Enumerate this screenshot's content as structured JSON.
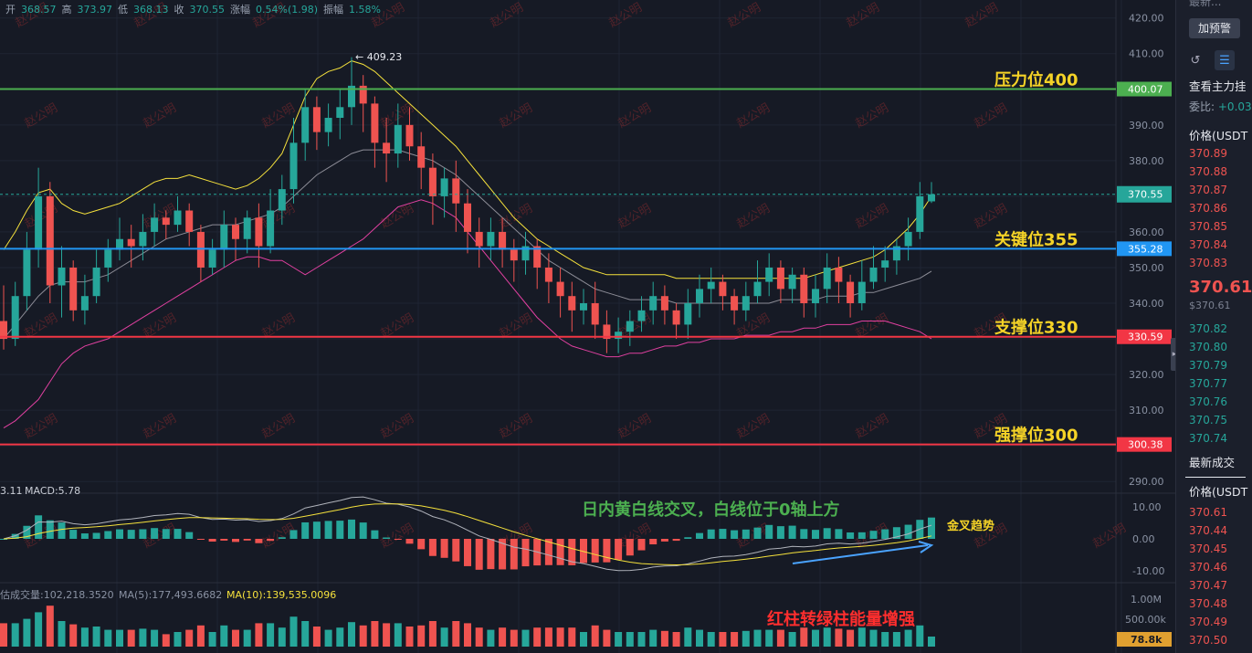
{
  "ohlc_header": {
    "open_label": "开",
    "open": "368.57",
    "high_label": "高",
    "high": "373.97",
    "low_label": "低",
    "low": "368.13",
    "close_label": "收",
    "close": "370.55",
    "change_label": "涨幅",
    "change": "0.54%(1.98)",
    "amplitude_label": "振幅",
    "amplitude": "1.58%"
  },
  "watermark_text": "赵公明",
  "colors": {
    "up": "#26a69a",
    "down": "#ef5350",
    "background": "#161a25",
    "resistance": "#4caf50",
    "key": "#2196f3",
    "support": "#f23645",
    "bb_upper": "#f5e13c",
    "bb_mid": "#8c8c96",
    "bb_lower": "#e040a0",
    "annotation_yellow": "#f5d327",
    "annotation_green": "#4caf50",
    "annotation_red": "#ff2e2e",
    "arrow_blue": "#4aa3ff"
  },
  "chart_data": [
    {
      "type": "candlestick",
      "panel": "price",
      "y_axis_ticks": [
        "420.00",
        "410.00",
        "400.00",
        "390.00",
        "380.00",
        "370.00",
        "360.00",
        "350.00",
        "340.00",
        "330.00",
        "320.00",
        "310.00",
        "300.00",
        "290.00"
      ],
      "ylim": [
        288,
        423
      ],
      "high_marker": "← 409.23",
      "candles": [
        [
          335,
          330,
          345,
          327
        ],
        [
          330,
          342,
          346,
          328
        ],
        [
          342,
          355,
          360,
          338
        ],
        [
          355,
          370,
          378,
          350
        ],
        [
          370,
          345,
          374,
          340
        ],
        [
          345,
          350,
          356,
          336
        ],
        [
          350,
          338,
          352,
          335
        ],
        [
          338,
          342,
          348,
          334
        ],
        [
          342,
          350,
          355,
          340
        ],
        [
          350,
          355,
          358,
          346
        ],
        [
          355,
          358,
          364,
          352
        ],
        [
          358,
          356,
          362,
          350
        ],
        [
          356,
          360,
          365,
          352
        ],
        [
          360,
          364,
          368,
          356
        ],
        [
          364,
          362,
          366,
          358
        ],
        [
          362,
          366,
          370,
          360
        ],
        [
          366,
          360,
          368,
          356
        ],
        [
          360,
          350,
          362,
          346
        ],
        [
          350,
          355,
          358,
          348
        ],
        [
          355,
          362,
          366,
          350
        ],
        [
          362,
          358,
          364,
          352
        ],
        [
          358,
          364,
          366,
          354
        ],
        [
          364,
          356,
          368,
          350
        ],
        [
          356,
          366,
          372,
          354
        ],
        [
          366,
          372,
          376,
          362
        ],
        [
          372,
          385,
          392,
          368
        ],
        [
          385,
          395,
          400,
          380
        ],
        [
          395,
          388,
          398,
          383
        ],
        [
          388,
          392,
          396,
          384
        ],
        [
          392,
          395,
          400,
          386
        ],
        [
          395,
          401,
          409,
          390
        ],
        [
          401,
          396,
          404,
          388
        ],
        [
          396,
          385,
          398,
          378
        ],
        [
          385,
          382,
          392,
          374
        ],
        [
          382,
          390,
          396,
          378
        ],
        [
          390,
          384,
          395,
          380
        ],
        [
          384,
          378,
          388,
          372
        ],
        [
          378,
          370,
          382,
          362
        ],
        [
          370,
          375,
          378,
          364
        ],
        [
          375,
          368,
          380,
          360
        ],
        [
          368,
          360,
          372,
          354
        ],
        [
          360,
          356,
          364,
          350
        ],
        [
          356,
          360,
          364,
          352
        ],
        [
          360,
          355,
          364,
          350
        ],
        [
          355,
          352,
          358,
          346
        ],
        [
          352,
          356,
          360,
          348
        ],
        [
          356,
          350,
          358,
          344
        ],
        [
          350,
          346,
          354,
          340
        ],
        [
          346,
          342,
          350,
          336
        ],
        [
          342,
          338,
          346,
          332
        ],
        [
          338,
          340,
          344,
          334
        ],
        [
          340,
          334,
          346,
          330
        ],
        [
          334,
          330,
          338,
          326
        ],
        [
          330,
          332,
          336,
          326
        ],
        [
          332,
          335,
          338,
          328
        ],
        [
          335,
          338,
          342,
          332
        ],
        [
          338,
          342,
          346,
          334
        ],
        [
          342,
          338,
          345,
          334
        ],
        [
          338,
          334,
          340,
          330
        ],
        [
          334,
          340,
          344,
          330
        ],
        [
          340,
          344,
          348,
          336
        ],
        [
          344,
          346,
          350,
          340
        ],
        [
          346,
          342,
          348,
          338
        ],
        [
          342,
          338,
          344,
          334
        ],
        [
          338,
          342,
          346,
          335
        ],
        [
          342,
          346,
          352,
          340
        ],
        [
          346,
          350,
          354,
          342
        ],
        [
          350,
          344,
          352,
          340
        ],
        [
          344,
          348,
          350,
          340
        ],
        [
          348,
          340,
          350,
          336
        ],
        [
          340,
          344,
          348,
          336
        ],
        [
          344,
          350,
          354,
          340
        ],
        [
          350,
          346,
          353,
          340
        ],
        [
          346,
          340,
          348,
          336
        ],
        [
          340,
          346,
          352,
          338
        ],
        [
          346,
          350,
          356,
          344
        ],
        [
          350,
          352,
          356,
          346
        ],
        [
          352,
          356,
          358,
          348
        ],
        [
          356,
          360,
          364,
          352
        ],
        [
          360,
          370,
          374,
          358
        ],
        [
          368.57,
          370.55,
          373.97,
          368.13
        ]
      ],
      "bollinger": {
        "upper": [
          355,
          360,
          366,
          371,
          372,
          368,
          366,
          365,
          366,
          367,
          368,
          370,
          372,
          374,
          375,
          375,
          376,
          375,
          374,
          373,
          372,
          373,
          375,
          378,
          382,
          390,
          398,
          403,
          405,
          406,
          408,
          407,
          405,
          402,
          399,
          396,
          393,
          390,
          387,
          384,
          380,
          376,
          372,
          368,
          364,
          361,
          358,
          356,
          354,
          352,
          350,
          349,
          348,
          348,
          348,
          348,
          348,
          348,
          347,
          347,
          347,
          347,
          347,
          347,
          347,
          347,
          347,
          347,
          347,
          347,
          348,
          349,
          350,
          351,
          352,
          353,
          355,
          358,
          361,
          365,
          370
        ],
        "mid": [
          330,
          334,
          338,
          342,
          345,
          346,
          346,
          346,
          347,
          348,
          350,
          352,
          354,
          356,
          358,
          359,
          360,
          361,
          362,
          362,
          362,
          363,
          364,
          365,
          367,
          370,
          373,
          376,
          378,
          380,
          382,
          383,
          383,
          383,
          383,
          382,
          381,
          380,
          378,
          376,
          373,
          370,
          367,
          364,
          361,
          358,
          355,
          352,
          350,
          348,
          346,
          344,
          343,
          342,
          341,
          341,
          341,
          341,
          340,
          340,
          340,
          340,
          340,
          340,
          340,
          340,
          340,
          341,
          341,
          341,
          341,
          342,
          342,
          342,
          343,
          343,
          344,
          345,
          346,
          347,
          349
        ],
        "lower": [
          305,
          307,
          310,
          313,
          318,
          323,
          326,
          328,
          329,
          330,
          332,
          334,
          336,
          338,
          340,
          342,
          344,
          346,
          348,
          350,
          352,
          353,
          353,
          352,
          352,
          350,
          348,
          350,
          352,
          354,
          356,
          358,
          361,
          364,
          367,
          368,
          369,
          368,
          366,
          364,
          360,
          356,
          352,
          348,
          344,
          340,
          336,
          333,
          330,
          328,
          327,
          326,
          325,
          325,
          326,
          326,
          327,
          328,
          328,
          329,
          329,
          330,
          330,
          330,
          331,
          331,
          331,
          332,
          332,
          333,
          333,
          334,
          334,
          334,
          335,
          335,
          335,
          334,
          333,
          332,
          330
        ]
      },
      "levels": [
        {
          "label": "压力位400",
          "value": "400.07"
        },
        {
          "label": "关键位355",
          "value": "355.28"
        },
        {
          "label": "支撑位330",
          "value": "330.59"
        },
        {
          "label": "强撑位300",
          "value": "300.38"
        }
      ],
      "last_price": "370.55"
    },
    {
      "type": "bar",
      "panel": "macd",
      "header_left": "3.11",
      "header_macd": "MACD:5.78",
      "y_axis_ticks": [
        "10.00",
        "0.00",
        "-10.00"
      ],
      "ylim": [
        -12,
        12
      ],
      "annotation": "日内黄白线交叉，白线位于0轴上方",
      "annotation2": "金叉趋势"
    },
    {
      "type": "bar",
      "panel": "volume",
      "header_vol": "估成交量:102,218.3520",
      "header_ma5": "MA(5):177,493.6682",
      "header_ma10": "MA(10):139,535.0096",
      "y_axis_ticks": [
        "1.00M",
        "500.00k"
      ],
      "last_vol": "78.8k",
      "annotation": "红柱转绿柱能量增强"
    }
  ],
  "sidebar": {
    "top_label": "最新...",
    "alert_button": "加预警",
    "main_order_label": "查看主力挂",
    "ratio_label": "委比:",
    "ratio_value": "+0.03",
    "price_header": "价格(USDT",
    "asks": [
      "370.89",
      "370.88",
      "370.87",
      "370.86",
      "370.85",
      "370.84",
      "370.83"
    ],
    "current_price": "370.61",
    "current_price_sub": "$370.61",
    "bids": [
      "370.82",
      "370.80",
      "370.79",
      "370.77",
      "370.76",
      "370.75",
      "370.74"
    ],
    "trades_title": "最新成交",
    "trades_header": "价格(USDT",
    "trades": [
      "370.61",
      "370.44",
      "370.45",
      "370.46",
      "370.47",
      "370.48",
      "370.49",
      "370.50"
    ]
  }
}
